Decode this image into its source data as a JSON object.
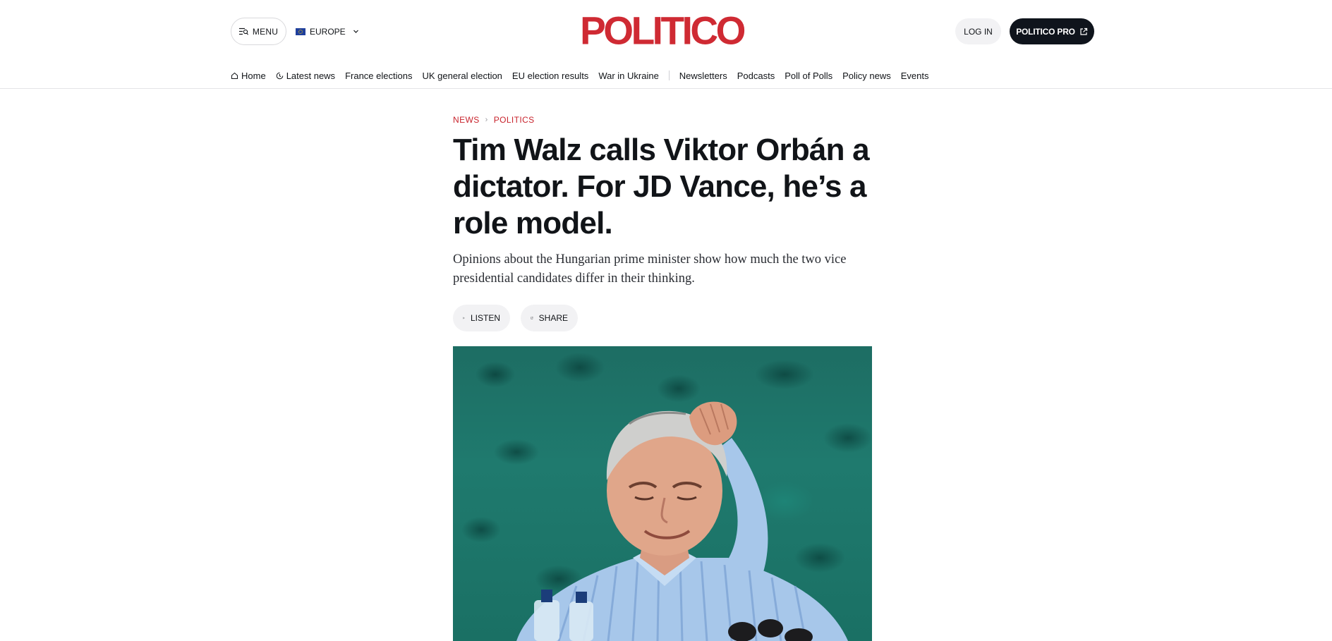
{
  "header": {
    "menu_label": "MENU",
    "region_label": "EUROPE",
    "logo_text": "POLITICO",
    "login_label": "LOG IN",
    "pro_label": "POLITICO PRO"
  },
  "nav": {
    "items": [
      "Home",
      "Latest news",
      "France elections",
      "UK general election",
      "EU election results",
      "War in Ukraine",
      "Newsletters",
      "Podcasts",
      "Poll of Polls",
      "Policy news",
      "Events"
    ]
  },
  "article": {
    "breadcrumb": [
      "NEWS",
      "POLITICS"
    ],
    "headline": "Tim Walz calls Viktor Orbán a dictator. For JD Vance, he’s a role model.",
    "dek": "Opinions about the Hungarian prime minister show how much the two vice presidential candidates differ in their thinking.",
    "listen_label": "LISTEN",
    "share_label": "SHARE"
  },
  "colors": {
    "brand_red": "#cf2a33",
    "pro_dark": "#0f141c",
    "photo_bg": "#1f7a6e"
  },
  "icons": {
    "menu": "menu-search-icon",
    "region_flag": "eu-flag-icon",
    "region_chevron": "chevron-down-icon",
    "pro_external": "external-link-icon",
    "home": "home-icon",
    "latest": "clock-icon",
    "listen": "play-icon",
    "share": "share-icon"
  }
}
